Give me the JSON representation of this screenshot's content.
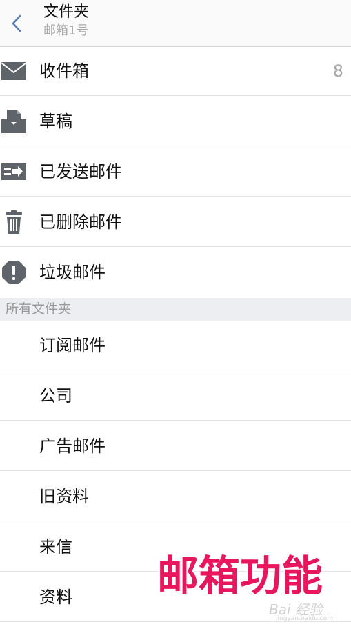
{
  "header": {
    "back_icon": "chevron-left-icon",
    "title": "文件夹",
    "subtitle": "邮箱1号"
  },
  "system_folders": [
    {
      "icon": "envelope-icon",
      "label": "收件箱",
      "count": "8"
    },
    {
      "icon": "draft-icon",
      "label": "草稿"
    },
    {
      "icon": "sent-icon",
      "label": "已发送邮件"
    },
    {
      "icon": "trash-icon",
      "label": "已删除邮件"
    },
    {
      "icon": "spam-icon",
      "label": "垃圾邮件"
    }
  ],
  "section": {
    "label": "所有文件夹"
  },
  "custom_folders": [
    {
      "label": "订阅邮件"
    },
    {
      "label": "公司"
    },
    {
      "label": "广告邮件"
    },
    {
      "label": "旧资料"
    },
    {
      "label": "来信"
    },
    {
      "label": "资料"
    }
  ],
  "overlay": {
    "caption": "邮箱功能"
  },
  "watermark": {
    "text": "Bai 经验",
    "sub": "jingyan.baidu.com"
  },
  "colors": {
    "icon_gray": "#5f646b",
    "back_arrow": "#5a7bb5",
    "caption": "#e8175d",
    "section_bg": "#eceef1"
  }
}
